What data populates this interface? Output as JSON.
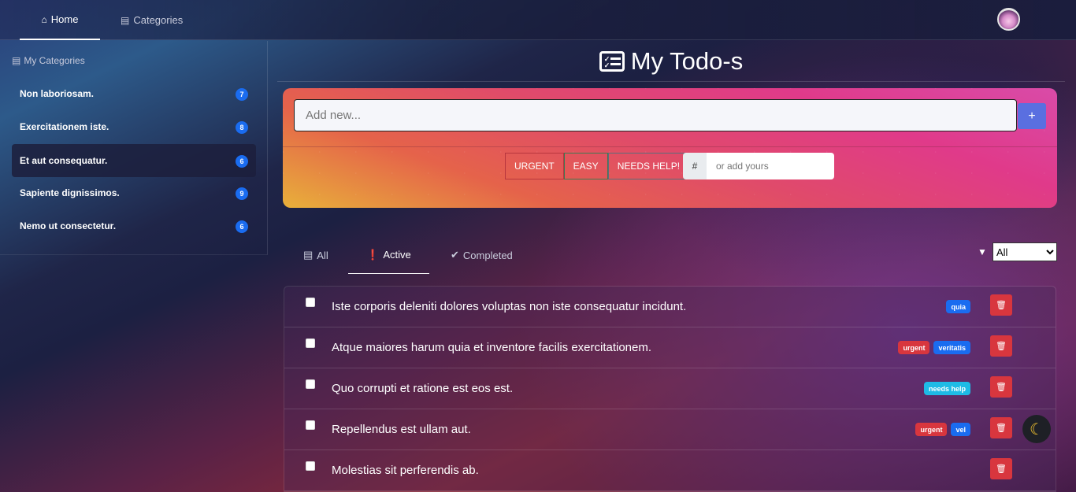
{
  "nav": {
    "home": "Home",
    "categories": "Categories"
  },
  "sidebar": {
    "title": "My Categories",
    "items": [
      {
        "label": "Non laboriosam.",
        "count": "7"
      },
      {
        "label": "Exercitationem iste.",
        "count": "8"
      },
      {
        "label": "Et aut consequatur.",
        "count": "6"
      },
      {
        "label": "Sapiente dignissimos.",
        "count": "9"
      },
      {
        "label": "Nemo ut consectetur.",
        "count": "6"
      }
    ]
  },
  "main": {
    "title": "My Todo-s",
    "add_placeholder": "Add new...",
    "add_button": "+",
    "tags": [
      "URGENT",
      "EASY",
      "NEEDS HELP!"
    ],
    "hash_prefix": "#",
    "hash_placeholder": "or add yours"
  },
  "tabs": {
    "all": "All",
    "active": "Active",
    "completed": "Completed"
  },
  "filter": {
    "selected": "All"
  },
  "todos": [
    {
      "text": "Iste corporis deleniti dolores voluptas non iste consequatur incidunt.",
      "tags": [
        {
          "label": "quia",
          "color": "blue"
        }
      ]
    },
    {
      "text": "Atque maiores harum quia et inventore facilis exercitationem.",
      "tags": [
        {
          "label": "urgent",
          "color": "red"
        },
        {
          "label": "veritatis",
          "color": "blue"
        }
      ]
    },
    {
      "text": "Quo corrupti et ratione est eos est.",
      "tags": [
        {
          "label": "needs help",
          "color": "cyan"
        }
      ]
    },
    {
      "text": "Repellendus est ullam aut.",
      "tags": [
        {
          "label": "urgent",
          "color": "red"
        },
        {
          "label": "vel",
          "color": "blue"
        }
      ]
    },
    {
      "text": "Molestias sit perferendis ab.",
      "tags": []
    }
  ],
  "colors": {
    "accent": "#1a6cf0",
    "danger": "#d8363e",
    "info": "#1ebbe6",
    "add_button": "#5a6fe0"
  },
  "icons": {
    "home": "home-icon",
    "categories": "list-icon",
    "delete": "trash-icon",
    "theme": "moon-icon",
    "filter": "filter-icon"
  }
}
